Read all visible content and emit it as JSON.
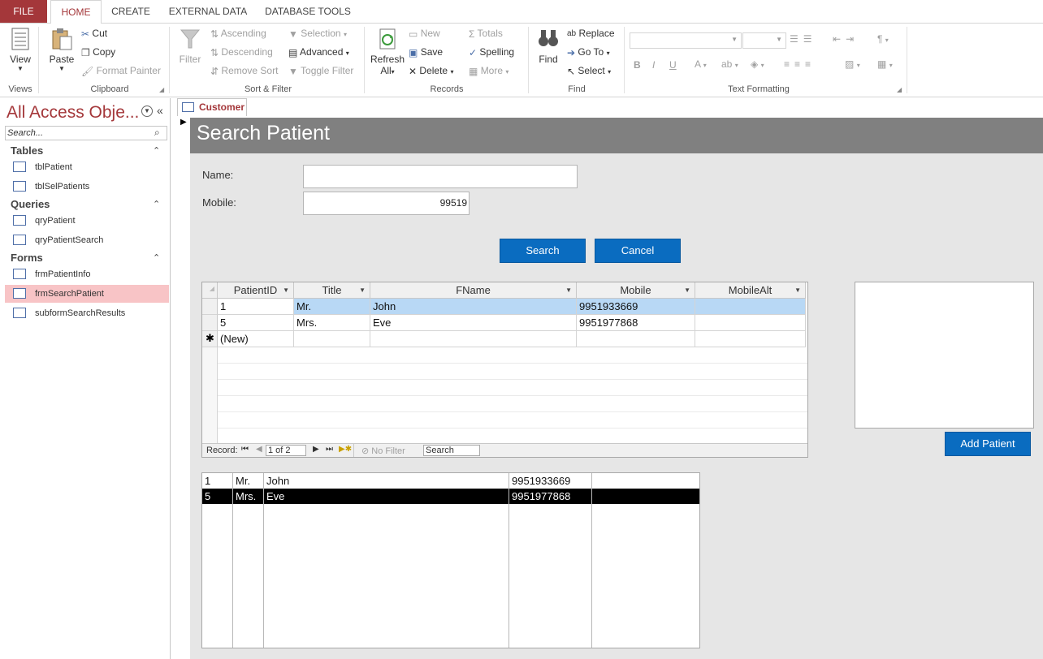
{
  "ribbon": {
    "tabs": [
      "FILE",
      "HOME",
      "CREATE",
      "EXTERNAL DATA",
      "DATABASE TOOLS"
    ],
    "groups": {
      "views": {
        "label": "Views",
        "view": "View"
      },
      "clipboard": {
        "label": "Clipboard",
        "paste": "Paste",
        "cut": "Cut",
        "copy": "Copy",
        "format_painter": "Format Painter"
      },
      "sort_filter": {
        "label": "Sort & Filter",
        "filter": "Filter",
        "ascending": "Ascending",
        "descending": "Descending",
        "remove_sort": "Remove Sort",
        "selection": "Selection",
        "advanced": "Advanced",
        "toggle_filter": "Toggle Filter"
      },
      "records": {
        "label": "Records",
        "refresh": "Refresh",
        "refresh_all": "All",
        "new": "New",
        "save": "Save",
        "delete": "Delete",
        "totals": "Totals",
        "spelling": "Spelling",
        "more": "More"
      },
      "find": {
        "label": "Find",
        "find": "Find",
        "replace": "Replace",
        "goto": "Go To",
        "select": "Select"
      },
      "text_formatting": {
        "label": "Text Formatting",
        "bold": "B",
        "italic": "I",
        "underline": "U"
      }
    }
  },
  "nav": {
    "title": "All Access Obje...",
    "search_placeholder": "Search...",
    "sections": [
      {
        "header": "Tables",
        "items": [
          "tblPatient",
          "tblSelPatients"
        ]
      },
      {
        "header": "Queries",
        "items": [
          "qryPatient",
          "qryPatientSearch"
        ]
      },
      {
        "header": "Forms",
        "items": [
          "frmPatientInfo",
          "frmSearchPatient",
          "subformSearchResults"
        ]
      }
    ],
    "selected": "frmSearchPatient"
  },
  "document": {
    "tab": "Customer",
    "form_title": "Search Patient",
    "name_label": "Name:",
    "name_value": "",
    "mobile_label": "Mobile:",
    "mobile_value": "99519",
    "search_button": "Search",
    "cancel_button": "Cancel",
    "add_patient_button": "Add Patient"
  },
  "datasheet": {
    "columns": [
      "PatientID",
      "Title",
      "FName",
      "Mobile",
      "MobileAlt"
    ],
    "rows": [
      [
        "1",
        "Mr.",
        "John",
        "9951933669",
        ""
      ],
      [
        "5",
        "Mrs.",
        "Eve",
        "9951977868",
        ""
      ]
    ],
    "new_row": "(New)",
    "nav": {
      "record_label": "Record:",
      "position": "1 of 2",
      "no_filter": "No Filter",
      "search": "Search"
    }
  },
  "listbox": {
    "rows": [
      [
        "1",
        "Mr.",
        "John",
        "9951933669",
        ""
      ],
      [
        "5",
        "Mrs.",
        "Eve",
        "9951977868",
        ""
      ]
    ],
    "selected_index": 1
  },
  "colors": {
    "accent": "#a4373a",
    "button_blue": "#0a6cc0",
    "form_bg": "#e6e6e6",
    "header_gray": "#808080",
    "nav_selected": "#f8c4c6"
  }
}
